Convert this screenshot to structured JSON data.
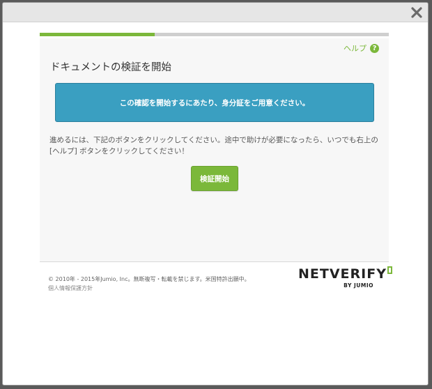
{
  "modal": {
    "close_icon": "close-icon"
  },
  "progress": {
    "step_fraction": 0.33,
    "fill_color": "#7cb83b",
    "track_color": "#cfcfcf"
  },
  "help": {
    "label": "ヘルプ",
    "icon": "help-icon",
    "icon_glyph": "?"
  },
  "title": "ドキュメントの検証を開始",
  "notice": "この確認を開始するにあたり、身分証をご用意ください。",
  "instructions": "進めるには、下記のボタンをクリックしてください。途中で助けが必要になったら、いつでも右上の [ヘルプ] ボタンをクリックしてください！",
  "start_button": "検証開始",
  "footer": {
    "copyright": "© 2010年 - 2015年Jumio, Inc。無断複写・転載を禁じます。米国特許出願中。",
    "privacy": "個人情報保護方針",
    "logo_main": "NETVERIFY",
    "logo_sub": "BY JUMIO"
  },
  "colors": {
    "accent_green": "#7cb83b",
    "notice_blue": "#3a9fc1"
  }
}
